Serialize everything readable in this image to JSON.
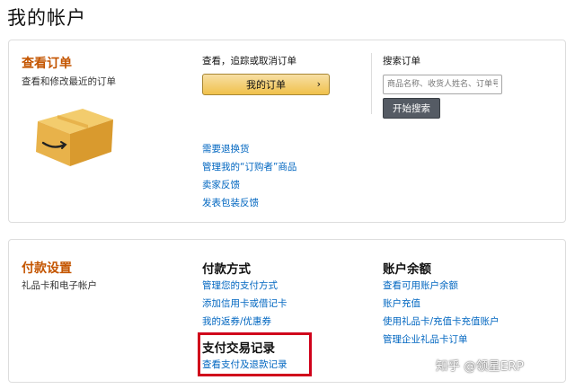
{
  "page": {
    "title": "我的帐户"
  },
  "orders": {
    "title": "查看订单",
    "subtitle": "查看和修改最近的订单",
    "view_label": "查看，追踪或取消订单",
    "my_orders_button": "我的订单",
    "chevron": "›",
    "search_label": "搜索订单",
    "search_placeholder": "商品名称、收货人姓名、订单号",
    "search_button": "开始搜索",
    "links": [
      "需要退换货",
      "管理我的“订购者”商品",
      "卖家反馈",
      "发表包装反馈"
    ]
  },
  "payments": {
    "title": "付款设置",
    "subtitle": "礼品卡和电子帐户",
    "methods": {
      "heading": "付款方式",
      "links": [
        "管理您的支付方式",
        "添加信用卡或借记卡",
        "我的返券/优惠券"
      ]
    },
    "transactions": {
      "heading": "支付交易记录",
      "link": "查看支付及退款记录"
    },
    "balance": {
      "heading": "账户余额",
      "links": [
        "查看可用账户余额",
        "账户充值",
        "使用礼品卡/充值卡充值账户",
        "管理企业礼品卡订单"
      ]
    }
  },
  "watermark": "知乎 @领星ERP",
  "colors": {
    "section_title": "#c45500",
    "link": "#0066c0",
    "highlight_border": "#d0021b",
    "button_yellow": "#f0c14b",
    "button_dark": "#555b64"
  }
}
